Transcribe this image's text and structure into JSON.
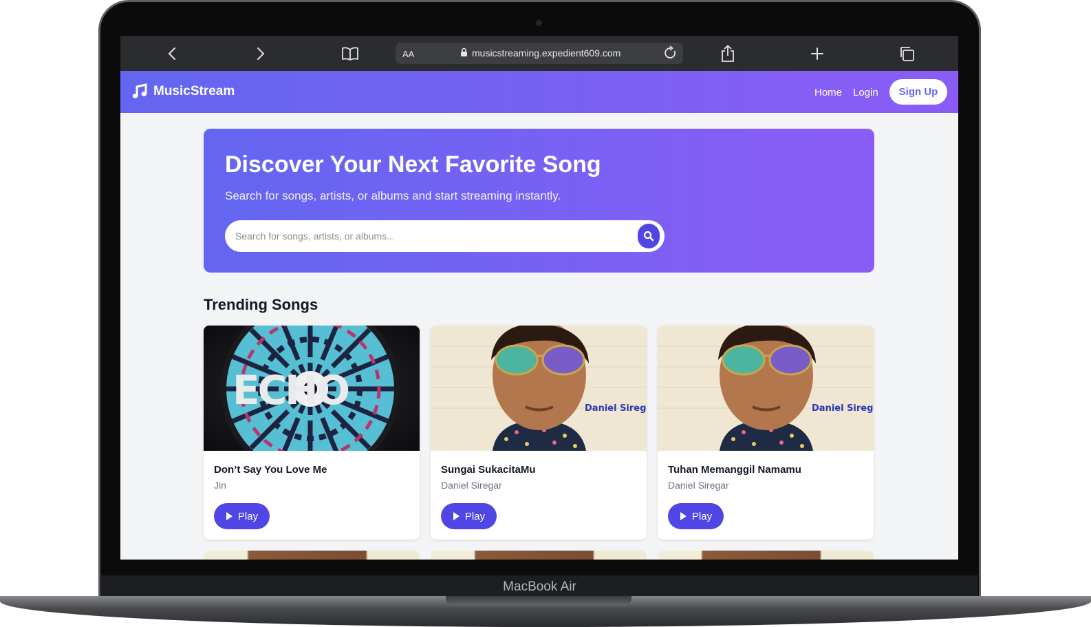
{
  "device": {
    "label": "MacBook Air"
  },
  "browser": {
    "text_size_label": "AA",
    "url": "musicstreaming.expedient609.com",
    "icons": [
      "back-icon",
      "forward-icon",
      "bookmarks-icon",
      "lock-icon",
      "reload-icon",
      "share-icon",
      "plus-icon",
      "tabs-icon"
    ]
  },
  "nav": {
    "brand": "MusicStream",
    "links": [
      "Home",
      "Login"
    ],
    "signup": "Sign Up"
  },
  "hero": {
    "title": "Discover Your Next Favorite Song",
    "subtitle": "Search for songs, artists, or albums and start streaming instantly.",
    "search_placeholder": "Search for songs, artists, or albums..."
  },
  "trending": {
    "heading": "Trending Songs",
    "play_label": "Play",
    "songs": [
      {
        "title": "Don’t Say You Love Me",
        "artist": "Jin",
        "cover_text": "ECHO"
      },
      {
        "title": "Sungai SukacitaMu",
        "artist": "Daniel Siregar",
        "cover_text": "Daniel Siregar"
      },
      {
        "title": "Tuhan Memanggil Namamu",
        "artist": "Daniel Siregar",
        "cover_text": "Daniel Siregar"
      }
    ]
  },
  "colors": {
    "gradient_start": "#6366f1",
    "gradient_end": "#8b5cf6",
    "button": "#4f46e5",
    "page_bg": "#f3f4f6"
  }
}
